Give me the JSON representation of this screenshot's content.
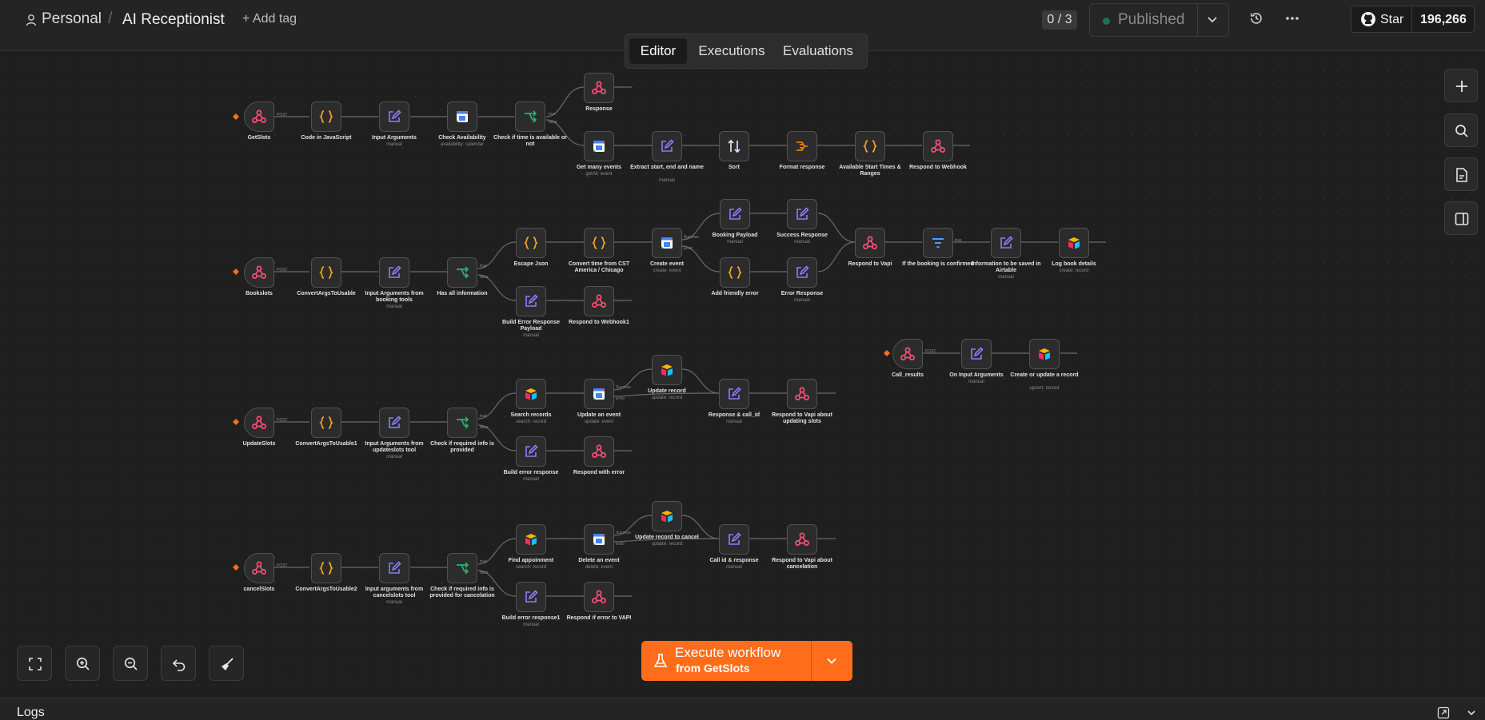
{
  "header": {
    "project": "Personal",
    "separator": "/",
    "workflow_name": "AI Receptionist",
    "add_tag": "+ Add tag",
    "counter": "0 / 3",
    "status": "Published",
    "github_star": "Star",
    "github_count": "196,266"
  },
  "tabs": {
    "editor": "Editor",
    "executions": "Executions",
    "evaluations": "Evaluations",
    "active": "Editor"
  },
  "execute": {
    "label": "Execute workflow",
    "sublabel": "from GetSlots"
  },
  "logs": {
    "title": "Logs"
  },
  "colors": {
    "accent": "#ff6d1a",
    "webhook": "#ff4d7a",
    "code": "#f5a623",
    "edit": "#8b7dff",
    "if": "#22b573",
    "sort": "#d7e3ff"
  },
  "nodes": {
    "getslots": {
      "label": "GetSlots"
    },
    "code_js": {
      "label": "Code in JavaScript"
    },
    "input_args": {
      "label": "Input Arguments",
      "sub": "manual"
    },
    "check_avail": {
      "label": "Check Availability",
      "sub": "availability: calendar"
    },
    "check_time": {
      "label": "Check if time is available or not"
    },
    "response": {
      "label": "Response"
    },
    "get_many_events": {
      "label": "Get many events",
      "sub": "getAll: event"
    },
    "extract": {
      "label": "Extract start, end and name",
      "sub": "manual"
    },
    "sort": {
      "label": "Sort"
    },
    "format_response": {
      "label": "Format response"
    },
    "available_start": {
      "label": "Available Start Times & Ranges"
    },
    "respond_webhook": {
      "label": "Respond to Webhook"
    },
    "bookslots": {
      "label": "Bookslots"
    },
    "convert_args": {
      "label": "ConvertArgsToUsable"
    },
    "input_booking": {
      "label": "Input Arguments from booking tools",
      "sub": "manual"
    },
    "has_all": {
      "label": "Has all information"
    },
    "escape_json": {
      "label": "Escape Json"
    },
    "convert_time": {
      "label": "Convert time from CST America / Chicago"
    },
    "create_event": {
      "label": "Create event",
      "sub": "create: event"
    },
    "booking_payload": {
      "label": "Booking Payload",
      "sub": "manual"
    },
    "success_response": {
      "label": "Success Response",
      "sub": "manual"
    },
    "add_friendly": {
      "label": "Add friendly error"
    },
    "error_response": {
      "label": "Error Response",
      "sub": "manual"
    },
    "respond_vapi": {
      "label": "Respond to Vapi"
    },
    "if_confirmed": {
      "label": "If the booking is confirmed"
    },
    "info_airtable": {
      "label": "Information to be saved in Airtable",
      "sub": "manual"
    },
    "log_book": {
      "label": "Log book details",
      "sub": "create: record"
    },
    "build_error_payload": {
      "label": "Build Error Response Payload",
      "sub": "manual"
    },
    "respond_webhook1": {
      "label": "Respond to Webhook1"
    },
    "call_results": {
      "label": "Call_results"
    },
    "on_input_args": {
      "label": "On Input Arguments",
      "sub": "manual"
    },
    "create_update_record": {
      "label": "Create or update a record",
      "sub": "upsert: record"
    },
    "updateslots": {
      "label": "UpdateSlots"
    },
    "convert_args1": {
      "label": "ConvertArgsToUsable1"
    },
    "input_update": {
      "label": "Input Arguments from updateslots tool",
      "sub": "manual"
    },
    "check_required": {
      "label": "Check if required info is provided"
    },
    "search_records": {
      "label": "Search records",
      "sub": "search: record"
    },
    "update_event": {
      "label": "Update an event",
      "sub": "update: event"
    },
    "update_record": {
      "label": "Update record",
      "sub": "update: record"
    },
    "response_callid": {
      "label": "Response & call_id",
      "sub": "manual"
    },
    "respond_vapi_update": {
      "label": "Respond to Vapi about updating slots"
    },
    "build_error_response": {
      "label": "Build error response",
      "sub": "manual"
    },
    "respond_with_error": {
      "label": "Respond with error"
    },
    "cancelslots": {
      "label": "cancelSlots"
    },
    "convert_args2": {
      "label": "ConvertArgsToUsable2"
    },
    "input_cancel": {
      "label": "Input arguments from cancelslots tool",
      "sub": "manual"
    },
    "check_required_cancel": {
      "label": "Check if required info is provided for cancelation"
    },
    "find_appointment": {
      "label": "Find appoinment",
      "sub": "search: record"
    },
    "delete_event": {
      "label": "Delete an event",
      "sub": "delete: event"
    },
    "update_record_cancel": {
      "label": "Update record to cancel",
      "sub": "update: record"
    },
    "call_id_response": {
      "label": "Call id & response",
      "sub": "manual"
    },
    "respond_vapi_cancel": {
      "label": "Respond to Vapi about cancelation"
    },
    "build_error_response1": {
      "label": "Build error response1",
      "sub": "manual"
    },
    "respond_error_vapi": {
      "label": "Respond if error to VAPI"
    }
  },
  "edge_labels": {
    "post": "POST",
    "true": "true",
    "false": "false",
    "success": "Success",
    "error": "Error"
  }
}
